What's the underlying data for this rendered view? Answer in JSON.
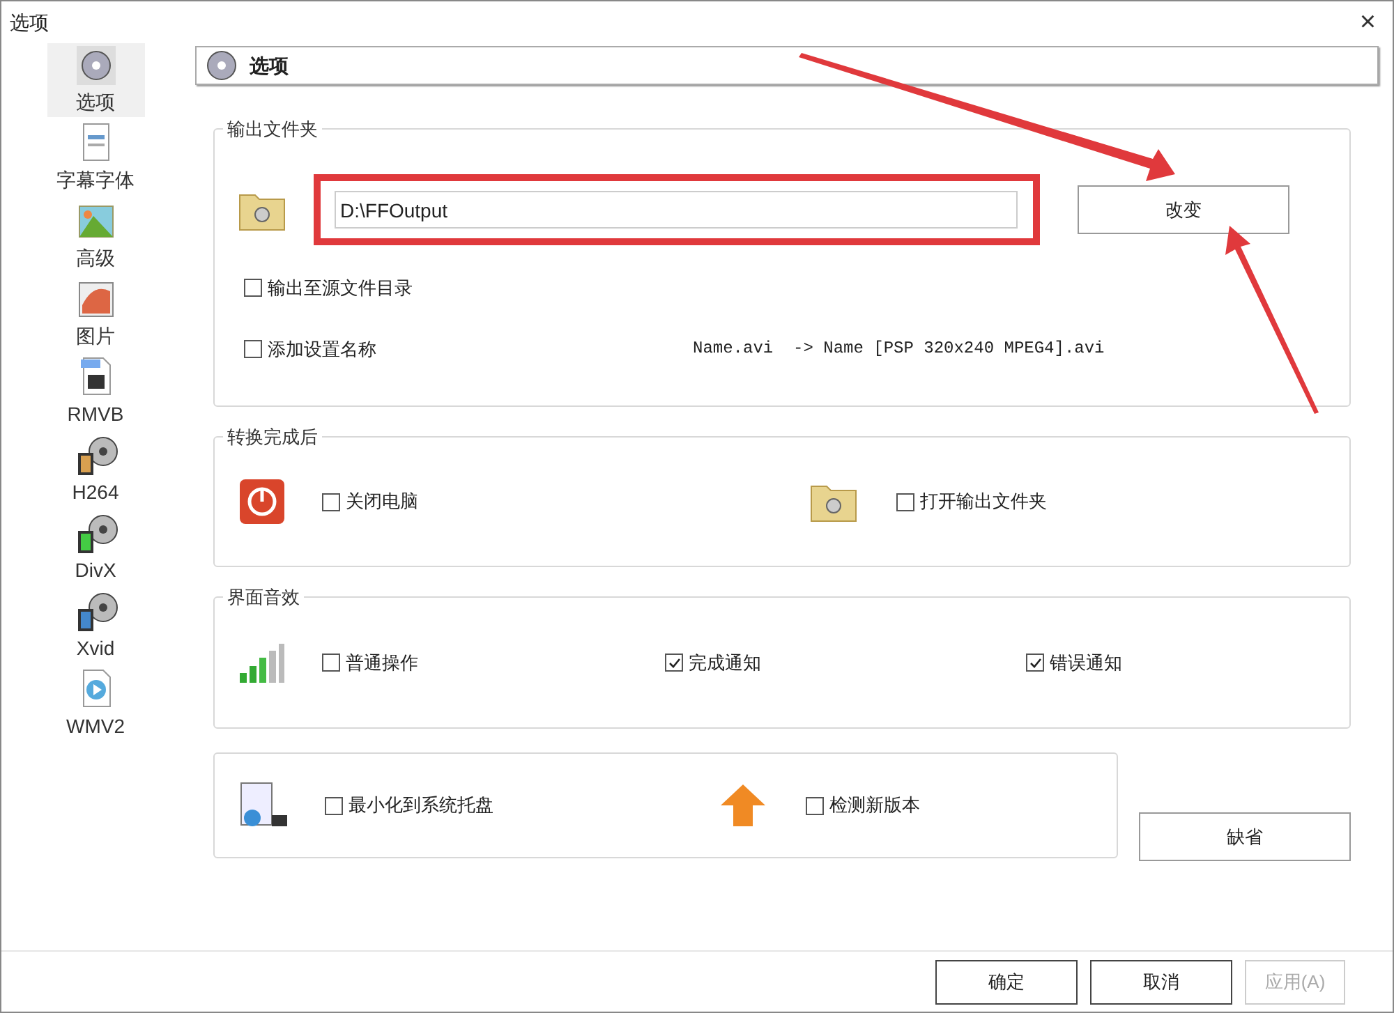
{
  "window": {
    "title": "选项",
    "close": "×"
  },
  "sidebar": {
    "items": [
      {
        "label": "选项",
        "selected": true
      },
      {
        "label": "字幕字体",
        "selected": false
      },
      {
        "label": "高级",
        "selected": false
      },
      {
        "label": "图片",
        "selected": false
      },
      {
        "label": "RMVB",
        "selected": false
      },
      {
        "label": "H264",
        "selected": false
      },
      {
        "label": "DivX",
        "selected": false
      },
      {
        "label": "Xvid",
        "selected": false
      },
      {
        "label": "WMV2",
        "selected": false
      }
    ]
  },
  "header": {
    "title": "选项"
  },
  "output_folder": {
    "title": "输出文件夹",
    "path": "D:\\FFOutput",
    "change_button": "改变",
    "options": [
      {
        "label": "输出至源文件目录",
        "checked": false
      },
      {
        "label": "添加设置名称",
        "checked": false
      }
    ],
    "example": "Name.avi  -> Name [PSP 320x240 MPEG4].avi"
  },
  "after_conversion": {
    "title": "转换完成后",
    "options": [
      {
        "label": "关闭电脑",
        "checked": false
      },
      {
        "label": "打开输出文件夹",
        "checked": false
      }
    ]
  },
  "sounds": {
    "title": "界面音效",
    "options": [
      {
        "label": "普通操作",
        "checked": false
      },
      {
        "label": "完成通知",
        "checked": true
      },
      {
        "label": "错误通知",
        "checked": true
      }
    ]
  },
  "misc": {
    "options": [
      {
        "label": "最小化到系统托盘",
        "checked": false
      },
      {
        "label": "检测新版本",
        "checked": false
      }
    ]
  },
  "default_button": "缺省",
  "footer": {
    "buttons": [
      {
        "label": "确定",
        "disabled": false
      },
      {
        "label": "取消",
        "disabled": false
      },
      {
        "label": "应用(A)",
        "disabled": true
      }
    ]
  }
}
